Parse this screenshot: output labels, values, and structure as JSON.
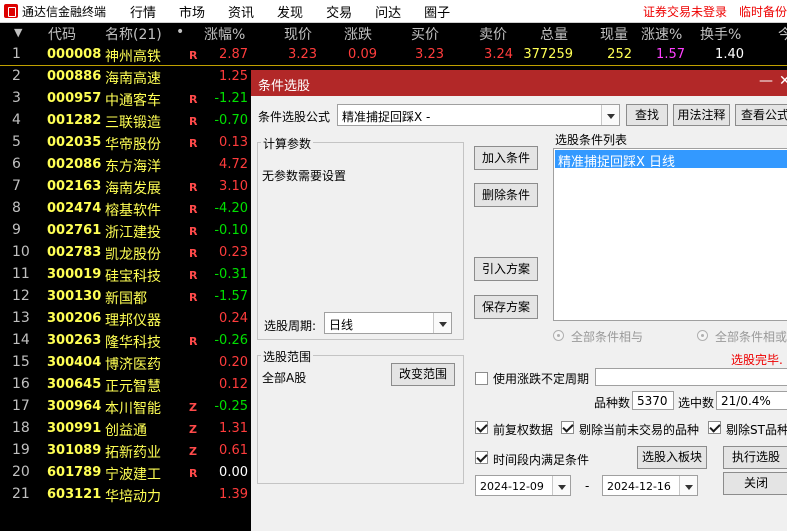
{
  "menubar": {
    "app_title": "通达信金融终端",
    "menus": [
      "行情",
      "市场",
      "资讯",
      "发现",
      "交易",
      "问达",
      "圈子"
    ],
    "status_login": "证券交易未登录",
    "status_temp": "临时备份"
  },
  "table": {
    "columns": [
      "代码",
      "名称(21)",
      "•",
      "涨幅%",
      "现价",
      "涨跌",
      "买价",
      "卖价",
      "总量",
      "现量",
      "涨速%",
      "换手%",
      "今"
    ],
    "rows": [
      {
        "idx": "1",
        "code": "000008",
        "name": "神州高铁",
        "flag": "R",
        "chg": "2.87",
        "dir": "up"
      },
      {
        "idx": "2",
        "code": "000886",
        "name": "海南高速",
        "flag": "",
        "chg": "1.25",
        "dir": "up"
      },
      {
        "idx": "3",
        "code": "000957",
        "name": "中通客车",
        "flag": "R",
        "chg": "-1.21",
        "dir": "down"
      },
      {
        "idx": "4",
        "code": "001282",
        "name": "三联锻造",
        "flag": "R",
        "chg": "-0.70",
        "dir": "down"
      },
      {
        "idx": "5",
        "code": "002035",
        "name": "华帝股份",
        "flag": "R",
        "chg": "0.13",
        "dir": "up"
      },
      {
        "idx": "6",
        "code": "002086",
        "name": "东方海洋",
        "flag": "",
        "chg": "4.72",
        "dir": "up"
      },
      {
        "idx": "7",
        "code": "002163",
        "name": "海南发展",
        "flag": "R",
        "chg": "3.10",
        "dir": "up"
      },
      {
        "idx": "8",
        "code": "002474",
        "name": "榕基软件",
        "flag": "R",
        "chg": "-4.20",
        "dir": "down"
      },
      {
        "idx": "9",
        "code": "002761",
        "name": "浙江建投",
        "flag": "R",
        "chg": "-0.10",
        "dir": "down"
      },
      {
        "idx": "10",
        "code": "002783",
        "name": "凯龙股份",
        "flag": "R",
        "chg": "0.23",
        "dir": "up"
      },
      {
        "idx": "11",
        "code": "300019",
        "name": "硅宝科技",
        "flag": "R",
        "chg": "-0.31",
        "dir": "down"
      },
      {
        "idx": "12",
        "code": "300130",
        "name": "新国都",
        "flag": "R",
        "chg": "-1.57",
        "dir": "down"
      },
      {
        "idx": "13",
        "code": "300206",
        "name": "理邦仪器",
        "flag": "",
        "chg": "0.24",
        "dir": "up"
      },
      {
        "idx": "14",
        "code": "300263",
        "name": "隆华科技",
        "flag": "R",
        "chg": "-0.26",
        "dir": "down"
      },
      {
        "idx": "15",
        "code": "300404",
        "name": "博济医药",
        "flag": "",
        "chg": "0.20",
        "dir": "up"
      },
      {
        "idx": "16",
        "code": "300645",
        "name": "正元智慧",
        "flag": "",
        "chg": "0.12",
        "dir": "up"
      },
      {
        "idx": "17",
        "code": "300964",
        "name": "本川智能",
        "flag": "Z",
        "chg": "-0.25",
        "dir": "down"
      },
      {
        "idx": "18",
        "code": "300991",
        "name": "创益通",
        "flag": "Z",
        "chg": "1.31",
        "dir": "up"
      },
      {
        "idx": "19",
        "code": "301089",
        "name": "拓新药业",
        "flag": "Z",
        "chg": "0.61",
        "dir": "up"
      },
      {
        "idx": "20",
        "code": "601789",
        "name": "宁波建工",
        "flag": "R",
        "chg": "0.00",
        "dir": "flat"
      },
      {
        "idx": "21",
        "code": "603121",
        "name": "华培动力",
        "flag": "",
        "chg": "1.39",
        "dir": "up"
      }
    ],
    "row1_extra": {
      "price": "3.23",
      "change": "0.09",
      "bid": "3.23",
      "ask": "3.24",
      "volume": "377259",
      "cur_vol": "252",
      "speed": "1.57",
      "turnover": "1.40"
    }
  },
  "dialog": {
    "title": "条件选股",
    "minimize": "—",
    "close": "✕",
    "formula_label": "条件选股公式",
    "formula_value": "精准捕捉回踩X -",
    "find_btn": "查找",
    "usage_btn": "用法注释",
    "view_btn": "查看公式",
    "params_title": "计算参数",
    "params_text": "无参数需要设置",
    "period_label": "选股周期:",
    "period_value": "日线",
    "add_btn": "加入条件",
    "del_btn": "删除条件",
    "import_btn": "引入方案",
    "save_btn": "保存方案",
    "cond_list_title": "选股条件列表",
    "cond_item": "精准捕捉回踩X  日线",
    "radio_and": "全部条件相与",
    "radio_or": "全部条件相或",
    "done_text": "选股完毕.",
    "range_title": "选股范围",
    "range_value": "全部A股",
    "change_range_btn": "改变范围",
    "use_limit_label": "使用涨跌不定周期",
    "count_label": "品种数",
    "count_value": "5370",
    "selected_label": "选中数",
    "selected_value": "21/0.4%",
    "fq_label": "前复权数据",
    "exclude_unlisted_label": "剔除当前未交易的品种",
    "exclude_st_label": "剔除ST品种",
    "time_range_label": "时间段内满足条件",
    "add_board_btn": "选股入板块",
    "exec_btn": "执行选股",
    "date_from": "2024-12-09",
    "date_sep": "-",
    "date_to": "2024-12-16",
    "close_btn": "关闭"
  }
}
